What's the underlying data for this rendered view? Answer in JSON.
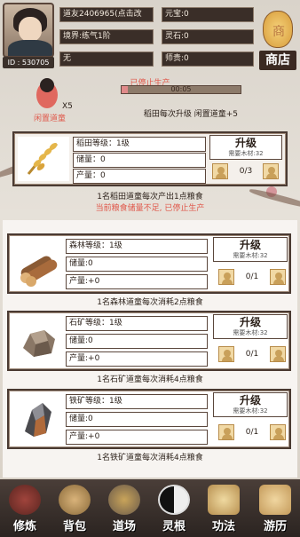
{
  "header": {
    "player_name": "道友2406965(点击改",
    "realm": "境界:练气1阶",
    "sect": "无",
    "yuanbao": "元宝:0",
    "spirit_stone": "灵石:0",
    "mentor_contribution": "师贵:0",
    "player_id": "ID : 530705",
    "shop_label": "商店"
  },
  "production": {
    "stopped_status": "已停止生产",
    "timer": "00:05",
    "progress": 0.05,
    "worker_count": "X5",
    "idle_label": "闲置道童",
    "rate_text": "稻田每次升级 闲置道童+5"
  },
  "rice": {
    "level": "稻田等级：1级",
    "stock": "储量：0",
    "output": "产量：0",
    "upgrade_label": "升级",
    "cost": "需要木材:32",
    "assigned": "0/3",
    "note": "1名稻田道童每次产出1点粮食",
    "warning": "当前粮食储量不足, 已停止生产"
  },
  "forest": {
    "level": "森林等级：1级",
    "stock": "储量:0",
    "output": "产量:+0",
    "upgrade_label": "升级",
    "cost": "需要木材:32",
    "assigned": "0/1",
    "note": "1名森林道童每次消耗2点粮食"
  },
  "stone": {
    "level": "石矿等级：1级",
    "stock": "储量:0",
    "output": "产量:+0",
    "upgrade_label": "升级",
    "cost": "需要木材:32",
    "assigned": "0/1",
    "note": "1名石矿道童每次消耗4点粮食"
  },
  "iron": {
    "level": "铁矿等级：1级",
    "stock": "储量:0",
    "output": "产量:+0",
    "upgrade_label": "升级",
    "cost": "需要木材:32",
    "assigned": "0/1",
    "note": "1名铁矿道童每次消耗4点粮食"
  },
  "nav": {
    "items": [
      {
        "label": "修炼",
        "icon": "cultivate-icon"
      },
      {
        "label": "背包",
        "icon": "bag-icon"
      },
      {
        "label": "道场",
        "icon": "dojo-icon"
      },
      {
        "label": "灵根",
        "icon": "spirit-root-icon"
      },
      {
        "label": "功法",
        "icon": "technique-icon"
      },
      {
        "label": "游历",
        "icon": "travel-icon"
      }
    ]
  },
  "colors": {
    "warning_red": "#e0574a",
    "dark_field": "#3a2e28",
    "frame": "#4a3a32"
  }
}
